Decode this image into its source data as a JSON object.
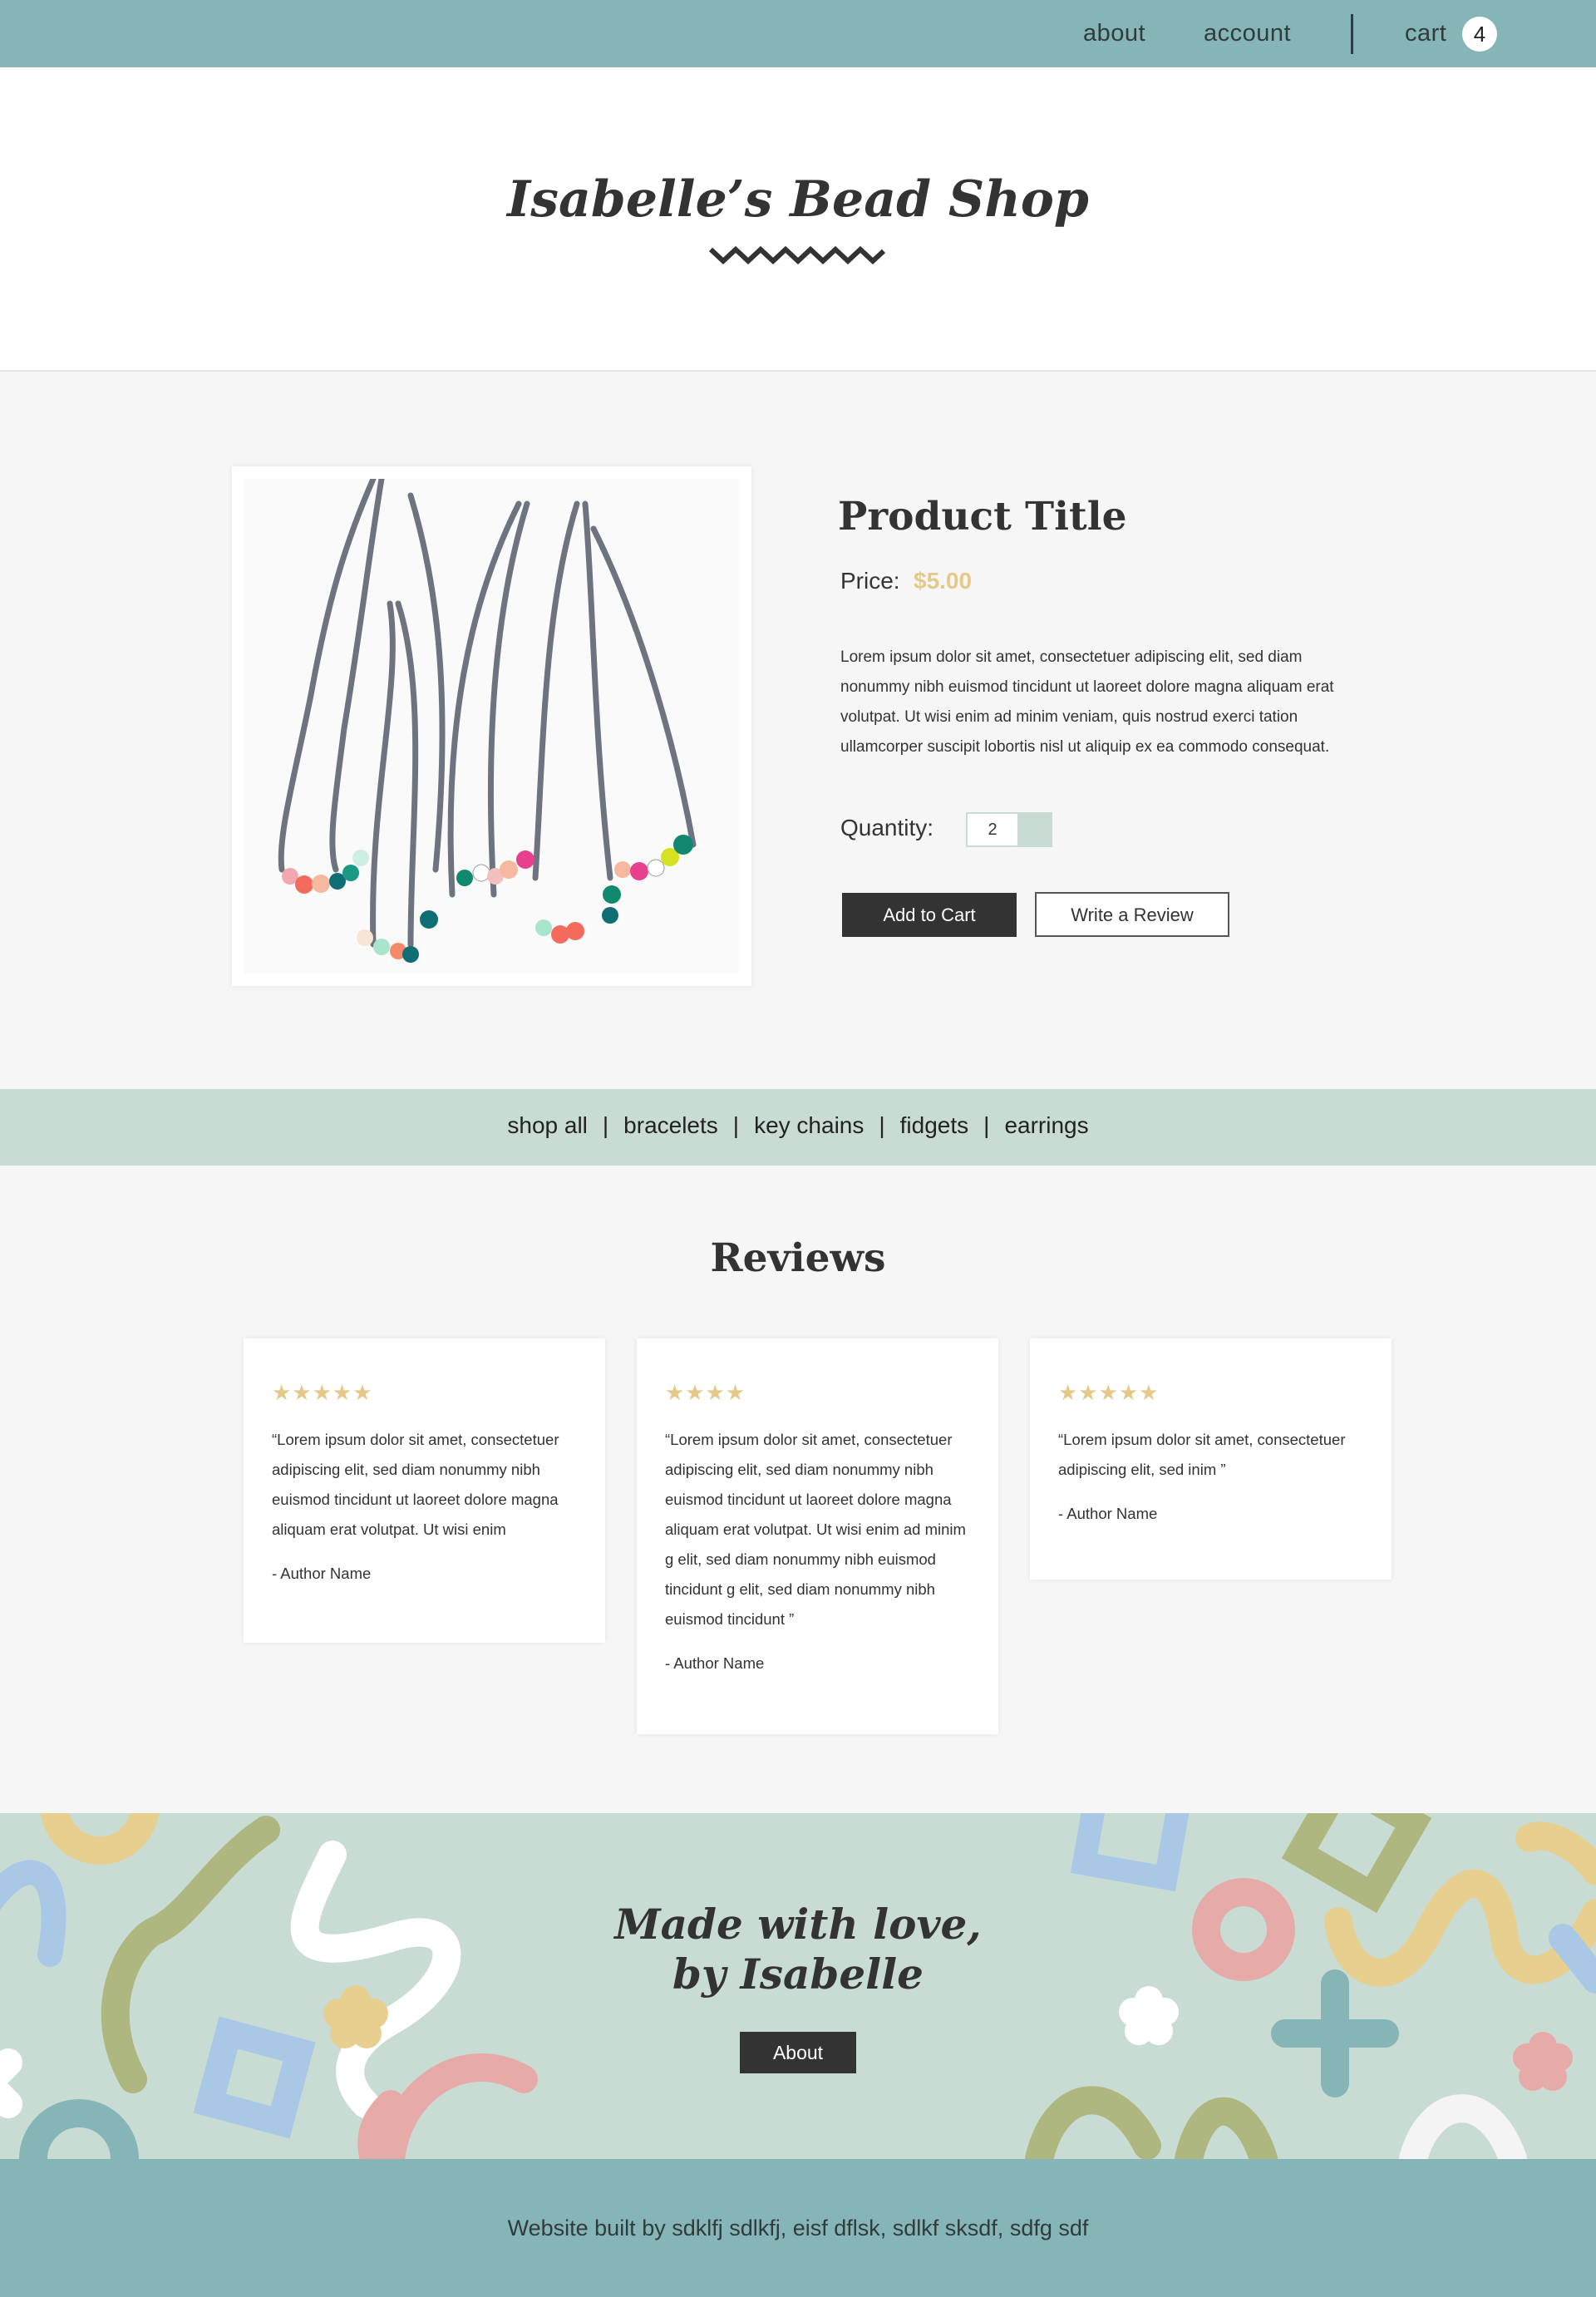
{
  "topnav": {
    "about": "about",
    "account": "account",
    "cart": "cart",
    "cart_count": "4"
  },
  "header": {
    "shop_title": "Isabelle’s Bead Shop"
  },
  "product": {
    "title": "Product Title",
    "price_label": "Price:",
    "price_value": "$5.00",
    "description": "Lorem ipsum dolor sit amet, consectetuer adipiscing elit, sed diam nonummy nibh euismod tincidunt ut laoreet dolore magna aliquam erat volutpat. Ut wisi enim ad minim veniam, quis nostrud exerci tation ullamcorper suscipit lobortis nisl ut aliquip ex ea commodo consequat.",
    "quantity_label": "Quantity:",
    "quantity_value": "2",
    "add_to_cart": "Add to Cart",
    "write_review": "Write a Review",
    "image_icon": "beaded-necklaces-photo"
  },
  "categories": {
    "items": [
      "shop all",
      "bracelets",
      "key chains",
      "fidgets",
      "earrings"
    ],
    "separator": "|"
  },
  "reviews": {
    "heading": "Reviews",
    "star_color": "#e5c98a",
    "items": [
      {
        "stars": "★★★★★",
        "rating": 5,
        "text": "“Lorem ipsum dolor sit amet, consectetuer adipiscing elit, sed diam nonummy nibh euismod tincidunt ut laoreet dolore magna aliquam erat volutpat. Ut wisi enim",
        "author": "-  Author Name"
      },
      {
        "stars": "★★★★",
        "rating": 4,
        "text": "“Lorem ipsum dolor sit amet, consectetuer adipiscing elit, sed diam nonummy nibh euismod tincidunt ut laoreet dolore magna aliquam erat volutpat. Ut wisi enim ad minim g elit, sed diam nonummy nibh euismod tincidunt g elit, sed diam nonummy nibh euismod tincidunt ”",
        "author": "-  Author Name"
      },
      {
        "stars": "★★★★★",
        "rating": 5,
        "text": "“Lorem ipsum dolor sit amet, consectetuer adipiscing elit, sed inim ”",
        "author": "-  Author Name"
      }
    ]
  },
  "footer": {
    "tagline_line1": "Made with love,",
    "tagline_line2": "by Isabelle",
    "about_button": "About",
    "credits": "Website built by sdklfj sdlkfj, eisf dflsk, sdlkf sksdf, sdfg sdf"
  },
  "colors": {
    "topbar": "#86b5b7",
    "mint": "#c9dcd3",
    "gold": "#e5c98a",
    "dark": "#333333"
  }
}
